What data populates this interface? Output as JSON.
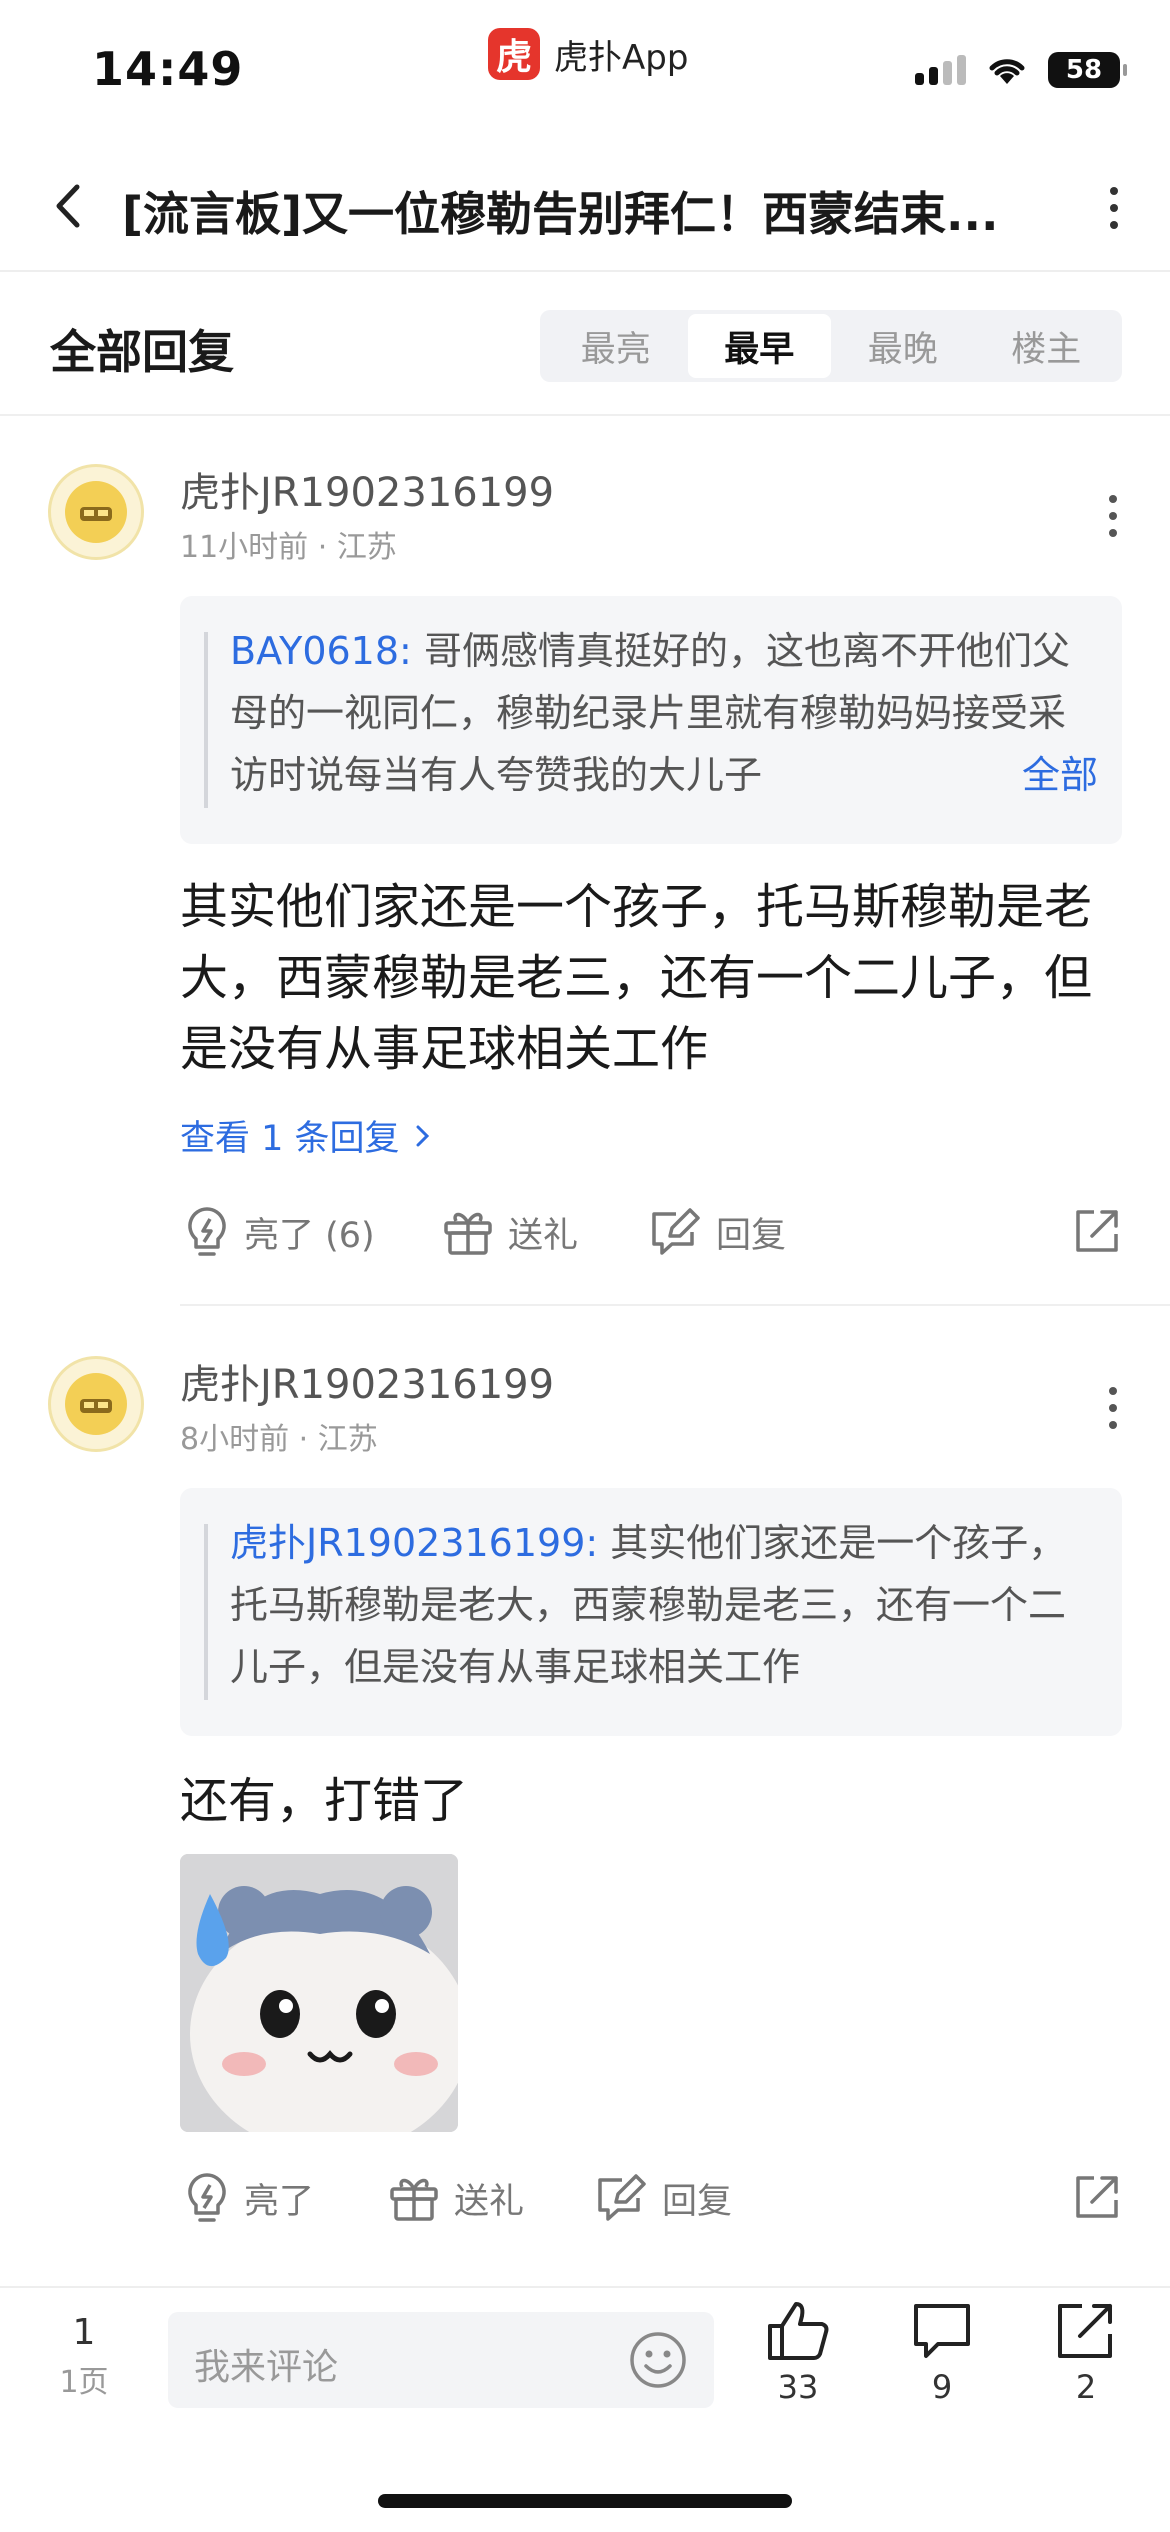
{
  "status_bar": {
    "time": "14:49",
    "app_logo_char": "虎",
    "app_name": "虎扑App",
    "battery": "58"
  },
  "nav": {
    "title": "[流言板]又一位穆勒告别拜仁！西蒙结束..."
  },
  "replies_header": {
    "title": "全部回复",
    "sort_tabs": [
      "最亮",
      "最早",
      "最晚",
      "楼主"
    ],
    "active_tab": "最早"
  },
  "replies": [
    {
      "username": "虎扑JR1902316199",
      "time": "11小时前",
      "location": "江苏",
      "quote_user": "BAY0618:",
      "quote_text": "哥俩感情真挺好的，这也离不开他们父母的一视同仁，穆勒纪录片里就有穆勒妈妈接受采访时说每当有人夸赞我的大儿子",
      "quote_more": "全部",
      "body": "其实他们家还是一个孩子，托马斯穆勒是老大，西蒙穆勒是老三，还有一个二儿子，但是没有从事足球相关工作",
      "view_replies": "查看 1 条回复",
      "light_label": "亮了 (6)",
      "gift_label": "送礼",
      "reply_label": "回复"
    },
    {
      "username": "虎扑JR1902316199",
      "time": "8小时前",
      "location": "江苏",
      "quote_user": "虎扑JR1902316199:",
      "quote_text": "其实他们家还是一个孩子，托马斯穆勒是老大，西蒙穆勒是老三，还有一个二儿子，但是没有从事足球相关工作",
      "body": "还有，打错了",
      "light_label": "亮了",
      "gift_label": "送礼",
      "reply_label": "回复"
    }
  ],
  "bottom_bar": {
    "page_current": "1",
    "page_total": "1页",
    "comment_placeholder": "我来评论",
    "like_count": "33",
    "comment_count": "9",
    "share_count": "2"
  },
  "colors": {
    "accent_blue": "#2d6ce0",
    "brand_red": "#e5352c"
  }
}
